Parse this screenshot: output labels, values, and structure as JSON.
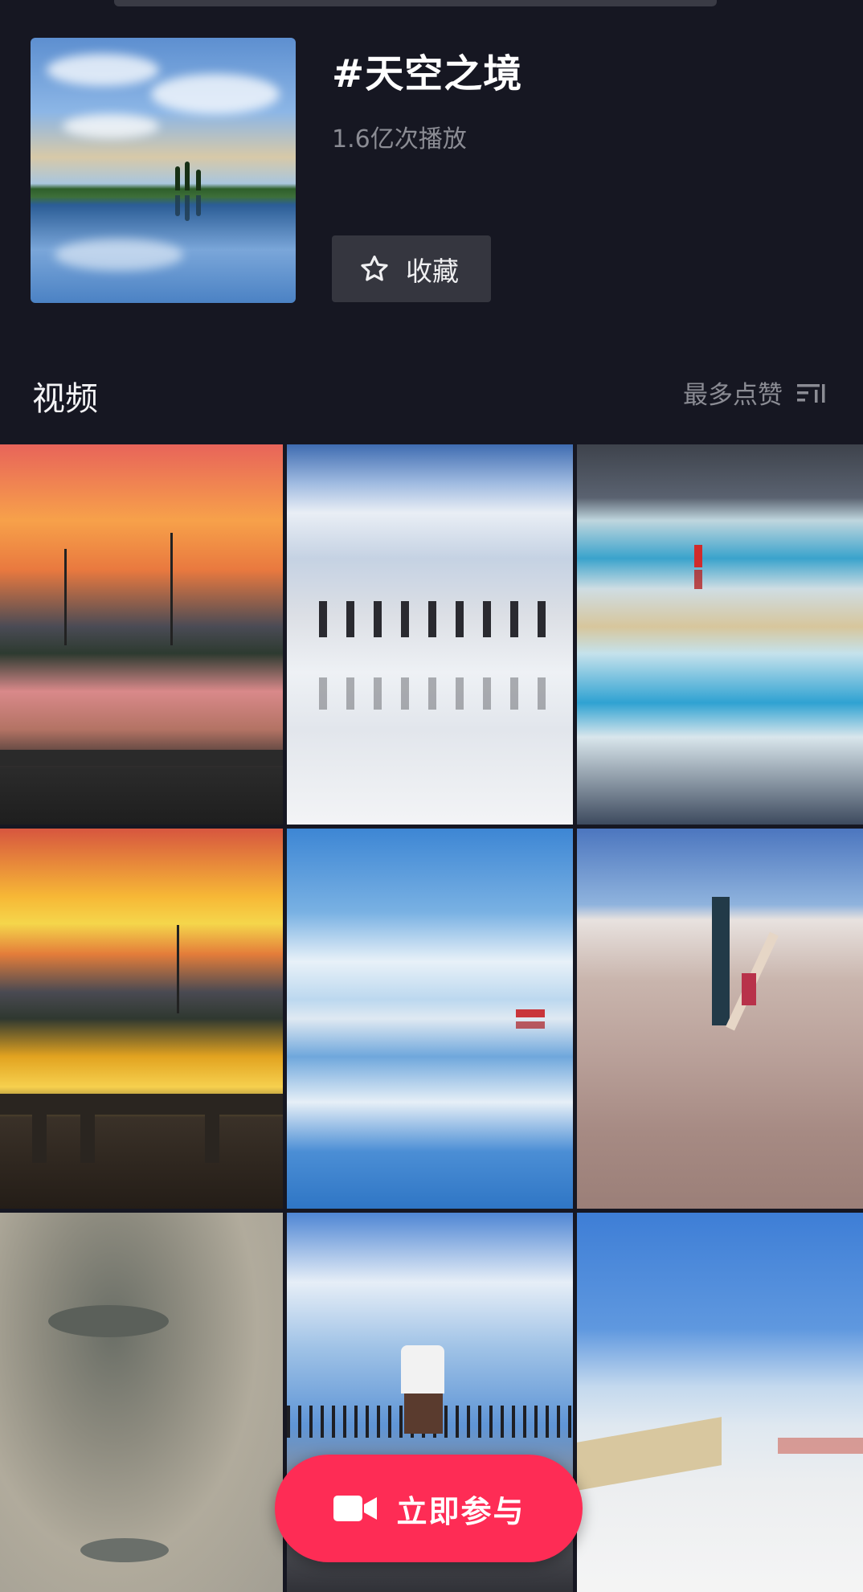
{
  "topic": {
    "hashtag": "#天空之境",
    "plays": "1.6亿次播放",
    "favorite_label": "收藏"
  },
  "section": {
    "title": "视频",
    "sort_label": "最多点赞"
  },
  "join_label": "立即参与",
  "icons": {
    "favorite": "star-outline-icon",
    "sort": "sort-filter-icon",
    "join": "video-camera-icon"
  },
  "colors": {
    "background": "#161722",
    "accent": "#fe2c55",
    "secondary_text": "#8b8c94",
    "button_bg": "#35363f"
  }
}
